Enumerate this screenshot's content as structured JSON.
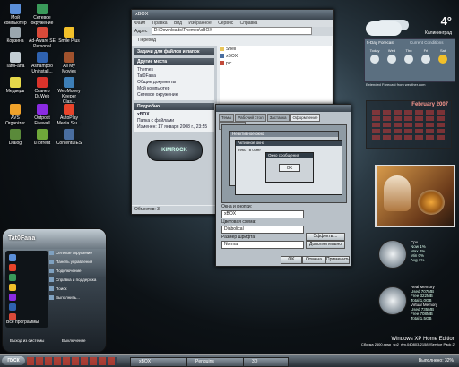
{
  "desktop_icons": [
    {
      "label": "Мой компьютер"
    },
    {
      "label": "Сетевое окружение"
    },
    {
      "label": "Корзина"
    },
    {
      "label": "Ad-Aware SE Personal"
    },
    {
      "label": "Smile Plus"
    },
    {
      "label": "Tat0Fana"
    },
    {
      "label": "Ashampoo Uninstall..."
    },
    {
      "label": "All My Movies"
    },
    {
      "label": "Медведь"
    },
    {
      "label": "Сканер Dr.Web"
    },
    {
      "label": "WebMoney Keeper Clas..."
    },
    {
      "label": "AVS Organizer"
    },
    {
      "label": "Outpost Firewall"
    },
    {
      "label": "AutoPlay Media Stu..."
    },
    {
      "label": "Dialog"
    },
    {
      "label": "uTorrent"
    },
    {
      "label": "ContentLIES"
    }
  ],
  "explorer": {
    "title": "xBOX",
    "menu": [
      "Файл",
      "Правка",
      "Вид",
      "Избранное",
      "Сервис",
      "Справка"
    ],
    "address_label": "Адрес",
    "address_value": "D:\\Downloads\\Themes\\xBOX",
    "go_label": "Переход",
    "task_title": "Задачи для файлов и папок",
    "places_title": "Другие места",
    "places": [
      "Themes",
      "Tat0Fana",
      "Общие документы",
      "Мой компьютер",
      "Сетевое окружение"
    ],
    "details_title": "Подробно",
    "details_name": "xBOX",
    "details_type": "Папка с файлами",
    "details_modified": "Изменен: 17 января 2008 г., 23:55",
    "files": [
      "Shell",
      "xBOX",
      "pic"
    ],
    "logo_text": "KIMROCK",
    "status_left": "Объектов: 3"
  },
  "dialog": {
    "tabs": [
      "Темы",
      "Рабочий стол",
      "Заставка",
      "Оформление",
      "Параметры"
    ],
    "active_tab": "Оформление",
    "preview_inactive": "Неактивное окно",
    "preview_active": "Активное окно",
    "preview_text": "Текст в окне",
    "preview_msgbox": "Окно сообщения",
    "preview_ok": "OK",
    "windows_buttons_label": "Окна и кнопки:",
    "windows_buttons_value": "xBOX",
    "color_scheme_label": "Цветовая схема:",
    "color_scheme_value": "Diabolical",
    "font_size_label": "Размер шрифта:",
    "font_size_value": "Normal",
    "effects_btn": "Эффекты...",
    "advanced_btn": "Дополнительно",
    "ok_btn": "OK",
    "cancel_btn": "Отмена",
    "apply_btn": "Применить"
  },
  "weather": {
    "temp": "4°",
    "city": "Калининград",
    "tab1": "5-Day Forecast",
    "tab2": "Current Conditions",
    "days": [
      "Today",
      "Wed",
      "Thu",
      "Fri",
      "Sat"
    ],
    "footer": "Extended Forecast from weather.com"
  },
  "calendar": {
    "title": "February 2007"
  },
  "meters": {
    "title1": "Cpu",
    "rows1": [
      "Now 1%",
      "Max 2%",
      "Min 0%",
      "Avg 1%"
    ],
    "title2": "Real Memory",
    "rows2": [
      "Used 707MB",
      "Free 322MB",
      "Total 1,0GB"
    ],
    "rows3": [
      "Used 735MB",
      "Free 708MB",
      "Total 1,5GB"
    ],
    "title3": "Virtual Memory"
  },
  "watermark": {
    "line1": "Windows XP Home Edition",
    "line2": "Сборка 2600.xpsp_sp2_rtm.040803-2158 (Service Pack 2)"
  },
  "start_menu": {
    "user": "Tat0Fana",
    "right_items": [
      "Сетевое окружение",
      "Панель управления",
      "Подключение",
      "Справка и поддержка",
      "Поиск",
      "Выполнить..."
    ],
    "all_programs": "Все программы",
    "logoff": "Выход из системы",
    "shutdown": "Выключение"
  },
  "taskbar": {
    "start": "ПУСК",
    "items": [
      "xBOX",
      "Penguins",
      "3D"
    ],
    "tray_text": "Выполнено: 32%"
  }
}
